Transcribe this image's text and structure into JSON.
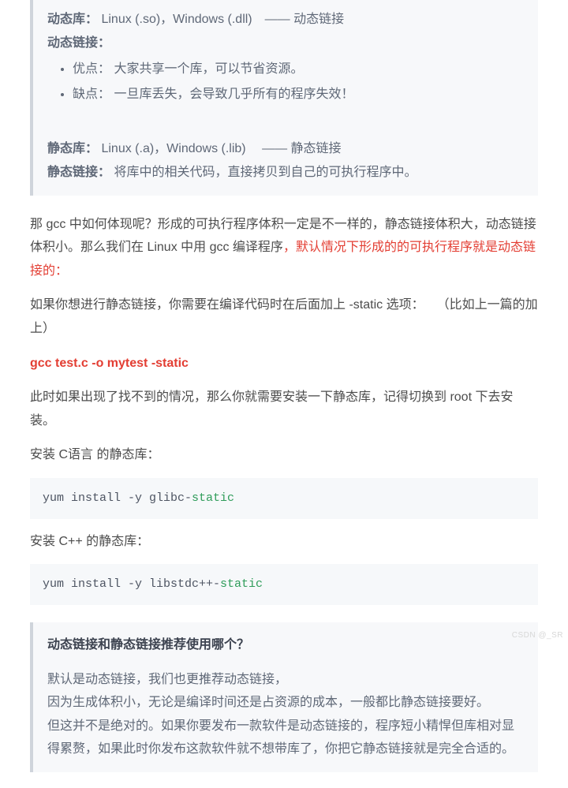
{
  "quote1": {
    "dynlib_label": "动态库：",
    "dynlib_text": "Linux (.so)，Windows (.dll) —— 动态链接",
    "dynlink_label": "动态链接：",
    "dynlink_pro_label": "优点：",
    "dynlink_pro_text": "大家共享一个库，可以节省资源。",
    "dynlink_con_label": "缺点：",
    "dynlink_con_text": "一旦库丢失，会导致几乎所有的程序失效！",
    "staticlib_label": "静态库：",
    "staticlib_text": "Linux (.a)，Windows (.lib)  —— 静态链接",
    "staticlink_label": "静态链接：",
    "staticlink_text": "将库中的相关代码，直接拷贝到自己的可执行程序中。"
  },
  "body": {
    "p1a": "那 gcc 中如何体现呢？形成的可执行程序体积一定是不一样的，静态链接体积大，动态链接体积小。那么我们在 Linux 中用 gcc 编译程序",
    "p1b": "，默认情况下形成的的可执行程序就是动态链接的：",
    "p2": "如果你想进行静态链接，你需要在编译代码时在后面加上 -static 选项： （比如上一篇的加上）",
    "cmd": "gcc test.c -o mytest -static",
    "p3": "此时如果出现了找不到的情况，那么你就需要安装一下静态库，记得切换到 root 下去安装。",
    "p4": "安装 C语言 的静态库：",
    "code1_a": "yum install -y glibc-",
    "code1_b": "static",
    "p5": "安装 C++ 的静态库：",
    "code2_a": "yum install -y libstdc++-",
    "code2_b": "static"
  },
  "quote2": {
    "title": "动态链接和静态链接推荐使用哪个？",
    "l1": "默认是动态链接，我们也更推荐动态链接，",
    "l2": "因为生成体积小，无论是编译时间还是占资源的成本，一般都比静态链接要好。",
    "l3": "但这并不是绝对的。如果你要发布一款软件是动态链接的，程序短小精悍但库相对显得累赘，如果此时你发布这款软件就不想带库了，你把它静态链接就是完全合适的。"
  },
  "watermark": "CSDN @_SR"
}
